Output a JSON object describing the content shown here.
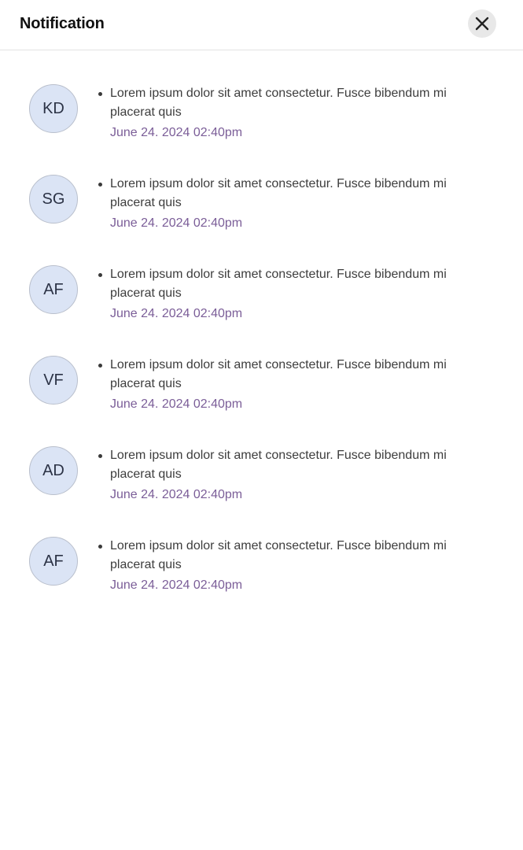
{
  "header": {
    "title": "Notification",
    "close_icon": "close-icon"
  },
  "notifications": [
    {
      "initials": "KD",
      "message": "Lorem ipsum dolor sit amet consectetur. Fusce bibendum mi placerat quis",
      "time": "June 24. 2024 02:40pm"
    },
    {
      "initials": "SG",
      "message": "Lorem ipsum dolor sit amet consectetur. Fusce bibendum mi placerat quis",
      "time": "June 24. 2024 02:40pm"
    },
    {
      "initials": "AF",
      "message": "Lorem ipsum dolor sit amet consectetur. Fusce bibendum mi placerat quis",
      "time": "June 24. 2024 02:40pm"
    },
    {
      "initials": "VF",
      "message": "Lorem ipsum dolor sit amet consectetur. Fusce bibendum mi placerat quis",
      "time": "June 24. 2024 02:40pm"
    },
    {
      "initials": "AD",
      "message": "Lorem ipsum dolor sit amet consectetur. Fusce bibendum mi placerat quis",
      "time": "June 24. 2024 02:40pm"
    },
    {
      "initials": "AF",
      "message": "Lorem ipsum dolor sit amet consectetur. Fusce bibendum mi placerat quis",
      "time": "June 24. 2024 02:40pm"
    }
  ],
  "colors": {
    "avatar_bg": "#dbe4f5",
    "time_text": "#7b5e98",
    "close_button_bg": "#e8e8e8"
  }
}
